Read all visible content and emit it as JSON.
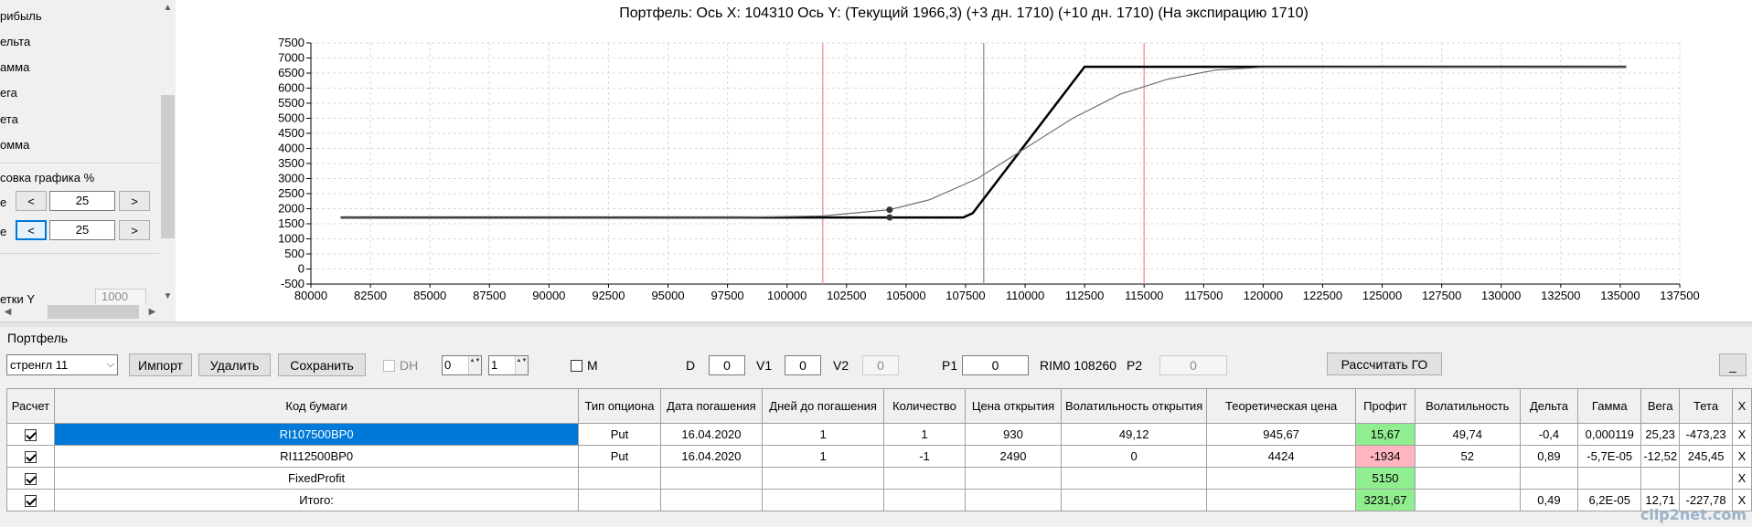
{
  "left_panel": {
    "items": [
      "рибыль",
      "ельта",
      "амма",
      "ега",
      "ета",
      "омма"
    ],
    "scale_label": "совка графика %",
    "row1": {
      "label": "е",
      "prev": "<",
      "value": "25",
      "next": ">"
    },
    "row2": {
      "label": "е",
      "prev": "<",
      "value": "25",
      "next": ">"
    },
    "grid_y_label": "етки Y",
    "grid_y_value": "1000",
    "scroll_up": "▲",
    "scroll_down": "▼",
    "scroll_left": "◀",
    "scroll_right": "▶"
  },
  "chart_data": {
    "type": "line",
    "title": "Портфель: Ось X: 104310 Ось Y:  (Текущий 1966,3)  (+3 дн. 1710)  (+10 дн. 1710)  (На экспирацию 1710)",
    "xlim": [
      80000,
      137500
    ],
    "ylim": [
      -500,
      7500
    ],
    "x_ticks": [
      80000,
      82500,
      85000,
      87500,
      90000,
      92500,
      95000,
      97500,
      100000,
      102500,
      105000,
      107500,
      110000,
      112500,
      115000,
      117500,
      120000,
      122500,
      125000,
      127500,
      130000,
      132500,
      135000,
      137500
    ],
    "y_ticks": [
      -500,
      0,
      500,
      1000,
      1500,
      2000,
      2500,
      3000,
      3500,
      4000,
      4500,
      5000,
      5500,
      6000,
      6500,
      7000,
      7500
    ],
    "grid": true,
    "vlines": [
      {
        "x": 101500,
        "color": "#f4a0a0"
      },
      {
        "x": 108260,
        "color": "#9aa0a8"
      },
      {
        "x": 115000,
        "color": "#f4a0a0"
      }
    ],
    "series": [
      {
        "color": "#000000",
        "x": [
          81250,
          107400,
          107800,
          112500,
          135250
        ],
        "y": [
          1710,
          1710,
          1850,
          6710,
          6710
        ]
      },
      {
        "color": "#707070",
        "x": [
          81250,
          98000,
          101500,
          104310,
          106000,
          108000,
          110000,
          112000,
          114000,
          116000,
          118000,
          120000,
          135250
        ],
        "y": [
          1710,
          1712,
          1760,
          1966,
          2300,
          3000,
          4000,
          5000,
          5800,
          6300,
          6600,
          6690,
          6710
        ]
      }
    ],
    "points": [
      {
        "x": 104310,
        "y": 1966
      },
      {
        "x": 104310,
        "y": 1710
      }
    ]
  },
  "portfolio": {
    "label": "Портфель",
    "combo_value": "стренгл 11",
    "combo_arrow": "⌵",
    "import_label": "Импорт",
    "delete_label": "Удалить",
    "save_label": "Сохранить",
    "dh_label": "DH",
    "spin1_value": "0",
    "spin2_value": "1",
    "spin_arrows": "▲▼",
    "m_label": "M",
    "d_label": "D",
    "d_value": "0",
    "v1_label": "V1",
    "v1_value": "0",
    "v2_label": "V2",
    "v2_value": "0",
    "p1_label": "P1",
    "p1_value": "0",
    "rim_text": "RIM0 108260",
    "p2_label": "P2",
    "p2_value": "0",
    "calc_go_label": "Рассчитать ГО",
    "min_label": "_"
  },
  "table": {
    "headers": [
      "Расчет",
      "Код бумаги",
      "Тип опциона",
      "Дата погашения",
      "Дней до погашения",
      "Количество",
      "Цена открытия",
      "Волатильность открытия",
      "Теоретическая цена",
      "Профит",
      "Волатильность",
      "Дельта",
      "Гамма",
      "Вега",
      "Тета",
      "X"
    ],
    "rows": [
      [
        "",
        "RI107500BP0",
        "Put",
        "16.04.2020",
        "1",
        "1",
        "930",
        "49,12",
        "945,67",
        "15,67",
        "49,74",
        "-0,4",
        "0,000119",
        "25,23",
        "-473,23",
        "X"
      ],
      [
        "",
        "RI112500BP0",
        "Put",
        "16.04.2020",
        "1",
        "-1",
        "2490",
        "0",
        "4424",
        "-1934",
        "52",
        "0,89",
        "-5,7E-05",
        "-12,52",
        "245,45",
        "X"
      ],
      [
        "",
        "FixedProfit",
        "",
        "",
        "",
        "",
        "",
        "",
        "",
        "5150",
        "",
        "",
        "",
        "",
        "",
        "X"
      ],
      [
        "",
        "Итого:",
        "",
        "",
        "",
        "",
        "",
        "",
        "",
        "3231,67",
        "",
        "0,49",
        "6,2E-05",
        "12,71",
        "-227,78",
        "X"
      ]
    ]
  },
  "watermark": "clip2net.com"
}
